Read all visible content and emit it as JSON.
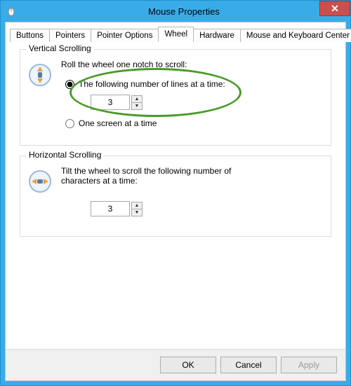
{
  "window": {
    "title": "Mouse Properties",
    "close_glyph": "✕"
  },
  "tabs": {
    "items": [
      "Buttons",
      "Pointers",
      "Pointer Options",
      "Wheel",
      "Hardware",
      "Mouse and Keyboard Center"
    ],
    "active_index": 3
  },
  "vertical": {
    "caption": "Vertical Scrolling",
    "desc": "Roll the wheel one notch to scroll:",
    "radio_lines_label": "The following number of lines at a time:",
    "radio_screen_label": "One screen at a time",
    "lines_value": "3",
    "selected": "lines"
  },
  "horizontal": {
    "caption": "Horizontal Scrolling",
    "desc": "Tilt the wheel to scroll the following number of characters at a time:",
    "chars_value": "3"
  },
  "buttons": {
    "ok": "OK",
    "cancel": "Cancel",
    "apply": "Apply"
  },
  "glyphs": {
    "up": "▲",
    "down": "▼"
  }
}
